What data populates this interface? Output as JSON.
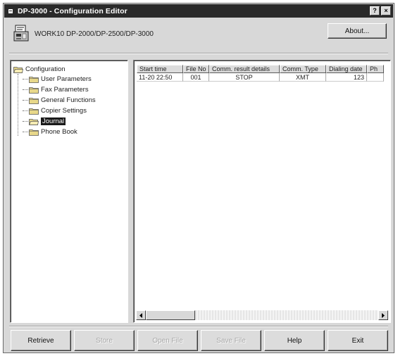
{
  "window": {
    "title": "DP-3000 - Configuration Editor",
    "help_btn": "?",
    "close_btn": "×"
  },
  "header": {
    "device_label": "WORK10 DP-2000/DP-2500/DP-3000",
    "about_label": "About..."
  },
  "tree": {
    "root": "Configuration",
    "items": [
      {
        "label": "User Parameters",
        "selected": false
      },
      {
        "label": "Fax Parameters",
        "selected": false
      },
      {
        "label": "General Functions",
        "selected": false
      },
      {
        "label": "Copier Settings",
        "selected": false
      },
      {
        "label": "Journal",
        "selected": true
      },
      {
        "label": "Phone Book",
        "selected": false
      }
    ]
  },
  "grid": {
    "headers": [
      "Start time",
      "File No",
      "Comm. result details",
      "Comm. Type",
      "Dialing date",
      "Ph"
    ],
    "rows": [
      [
        "11-20 22:50",
        "001",
        "STOP",
        "XMT",
        "123",
        ""
      ]
    ]
  },
  "buttons": {
    "retrieve": "Retrieve",
    "store": "Store",
    "open_file": "Open File",
    "save_file": "Save File",
    "help": "Help",
    "exit": "Exit"
  },
  "colors": {
    "titlebar": "#2a2a2a",
    "face": "#d8d8d8",
    "folder": "#e8d88a"
  }
}
